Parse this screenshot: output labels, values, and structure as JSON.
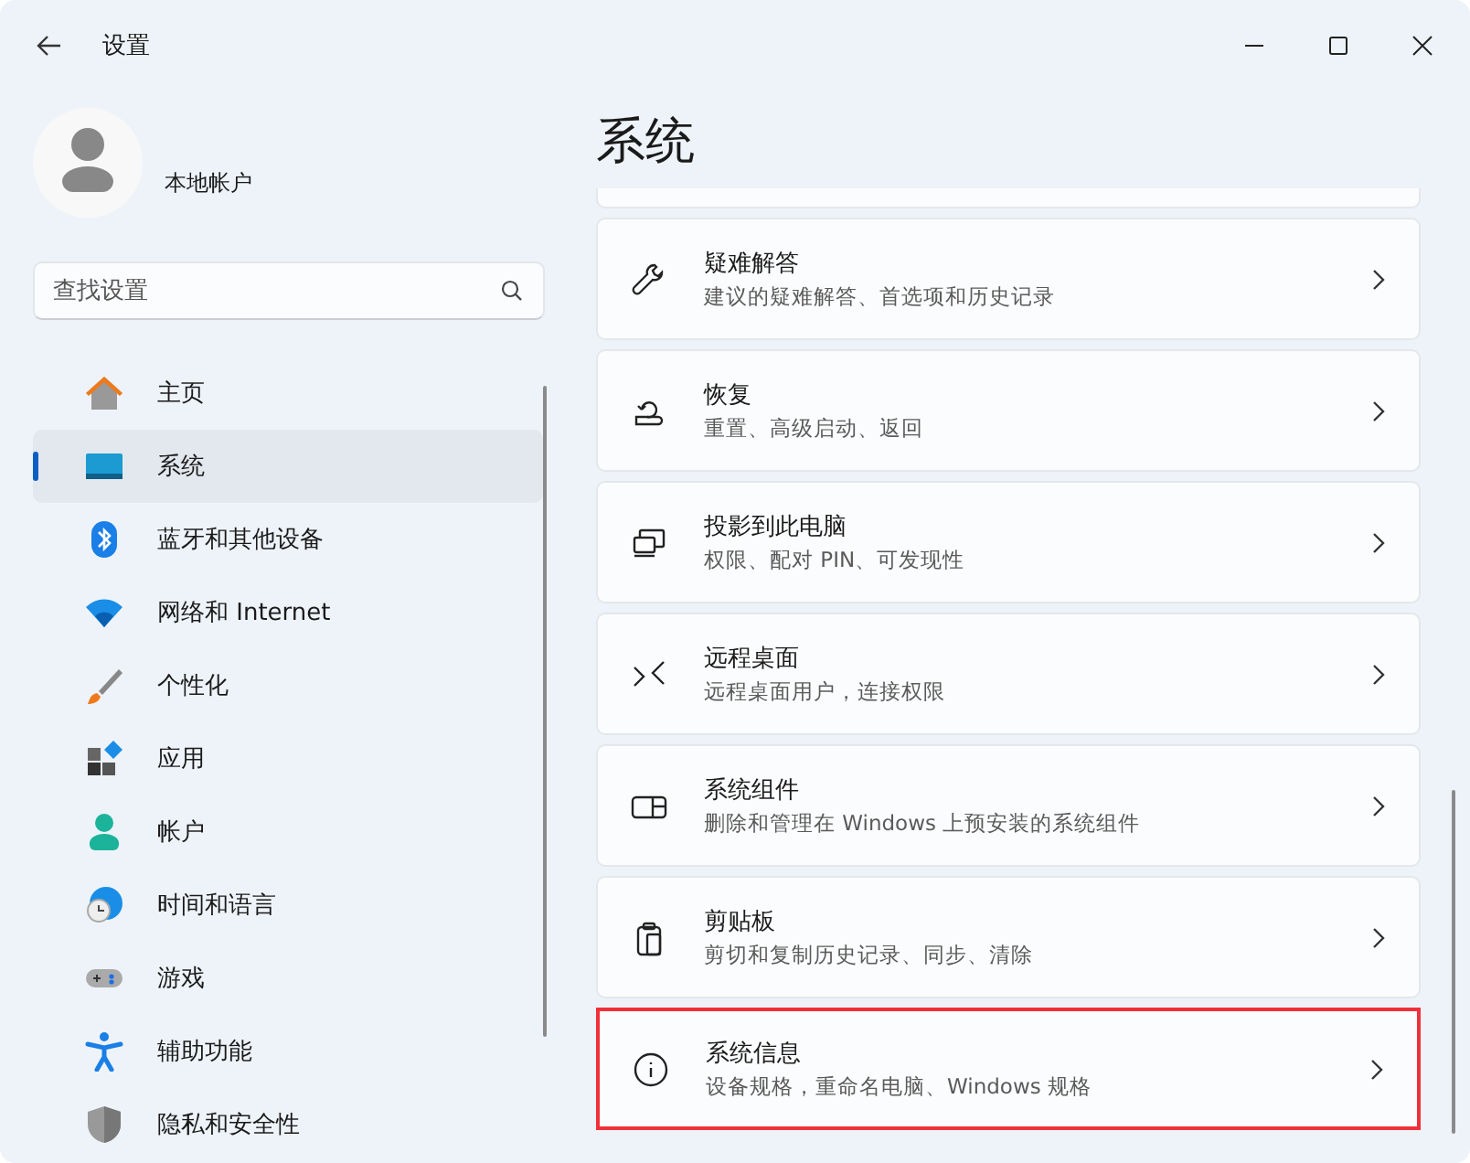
{
  "window": {
    "title": "设置"
  },
  "account": {
    "name": "本地帐户"
  },
  "search": {
    "placeholder": "查找设置"
  },
  "nav": [
    {
      "label": "主页",
      "selected": false
    },
    {
      "label": "系统",
      "selected": true
    },
    {
      "label": "蓝牙和其他设备",
      "selected": false
    },
    {
      "label": "网络和 Internet",
      "selected": false
    },
    {
      "label": "个性化",
      "selected": false
    },
    {
      "label": "应用",
      "selected": false
    },
    {
      "label": "帐户",
      "selected": false
    },
    {
      "label": "时间和语言",
      "selected": false
    },
    {
      "label": "游戏",
      "selected": false
    },
    {
      "label": "辅助功能",
      "selected": false
    },
    {
      "label": "隐私和安全性",
      "selected": false
    }
  ],
  "page": {
    "title": "系统"
  },
  "settings": [
    {
      "title": "疑难解答",
      "subtitle": "建议的疑难解答、首选项和历史记录",
      "highlighted": false
    },
    {
      "title": "恢复",
      "subtitle": "重置、高级启动、返回",
      "highlighted": false
    },
    {
      "title": "投影到此电脑",
      "subtitle": "权限、配对 PIN、可发现性",
      "highlighted": false
    },
    {
      "title": "远程桌面",
      "subtitle": "远程桌面用户，连接权限",
      "highlighted": false
    },
    {
      "title": "系统组件",
      "subtitle": "删除和管理在 Windows 上预安装的系统组件",
      "highlighted": false
    },
    {
      "title": "剪贴板",
      "subtitle": "剪切和复制历史记录、同步、清除",
      "highlighted": false
    },
    {
      "title": "系统信息",
      "subtitle": "设备规格，重命名电脑、Windows 规格",
      "highlighted": true
    }
  ]
}
